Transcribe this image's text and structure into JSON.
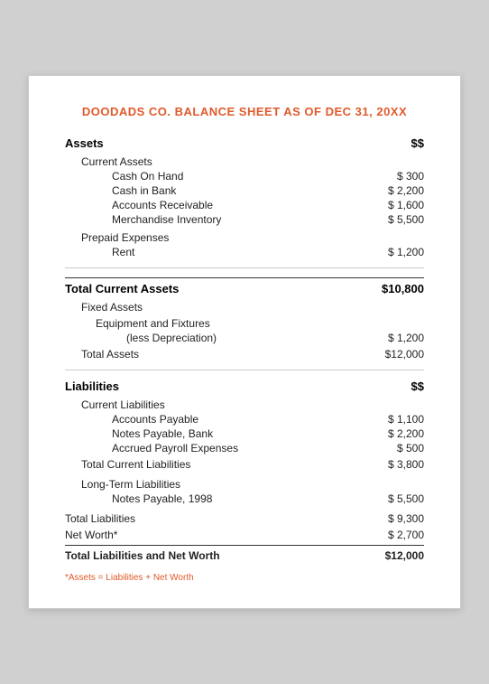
{
  "title": "DOODADS CO. BALANCE SHEET AS OF DEC 31, 20XX",
  "assets_header": "Assets",
  "assets_symbol": "$$",
  "current_assets_label": "Current Assets",
  "cash_on_hand_label": "Cash On Hand",
  "cash_on_hand_amount": "$ 300",
  "cash_in_bank_label": "Cash in Bank",
  "cash_in_bank_amount": "$ 2,200",
  "accounts_receivable_label": "Accounts Receivable",
  "accounts_receivable_amount": "$ 1,600",
  "merchandise_inventory_label": "Merchandise Inventory",
  "merchandise_inventory_amount": "$ 5,500",
  "prepaid_expenses_label": "Prepaid Expenses",
  "rent_label": "Rent",
  "rent_amount": "$ 1,200",
  "total_current_assets_label": "Total Current Assets",
  "total_current_assets_amount": "$10,800",
  "fixed_assets_label": "Fixed Assets",
  "equipment_fixtures_label": "Equipment and Fixtures",
  "less_depreciation_label": "(less Depreciation)",
  "less_depreciation_amount": "$ 1,200",
  "total_assets_label": "Total Assets",
  "total_assets_amount": "$12,000",
  "liabilities_header": "Liabilities",
  "liabilities_symbol": "$$",
  "current_liabilities_label": "Current Liabilities",
  "accounts_payable_label": "Accounts Payable",
  "accounts_payable_amount": "$ 1,100",
  "notes_payable_bank_label": "Notes Payable, Bank",
  "notes_payable_bank_amount": "$ 2,200",
  "accrued_payroll_label": "Accrued Payroll Expenses",
  "accrued_payroll_amount": "$ 500",
  "total_current_liabilities_label": "Total Current Liabilities",
  "total_current_liabilities_amount": "$ 3,800",
  "long_term_liabilities_label": "Long-Term Liabilities",
  "notes_payable_1998_label": "Notes Payable, 1998",
  "notes_payable_1998_amount": "$ 5,500",
  "total_liabilities_label": "Total Liabilities",
  "total_liabilities_amount": "$ 9,300",
  "net_worth_label": "Net Worth*",
  "net_worth_amount": "$ 2,700",
  "total_liabilities_net_worth_label": "Total Liabilities and Net Worth",
  "total_liabilities_net_worth_amount": "$12,000",
  "footnote": "*Assets = Liabilities + Net Worth"
}
